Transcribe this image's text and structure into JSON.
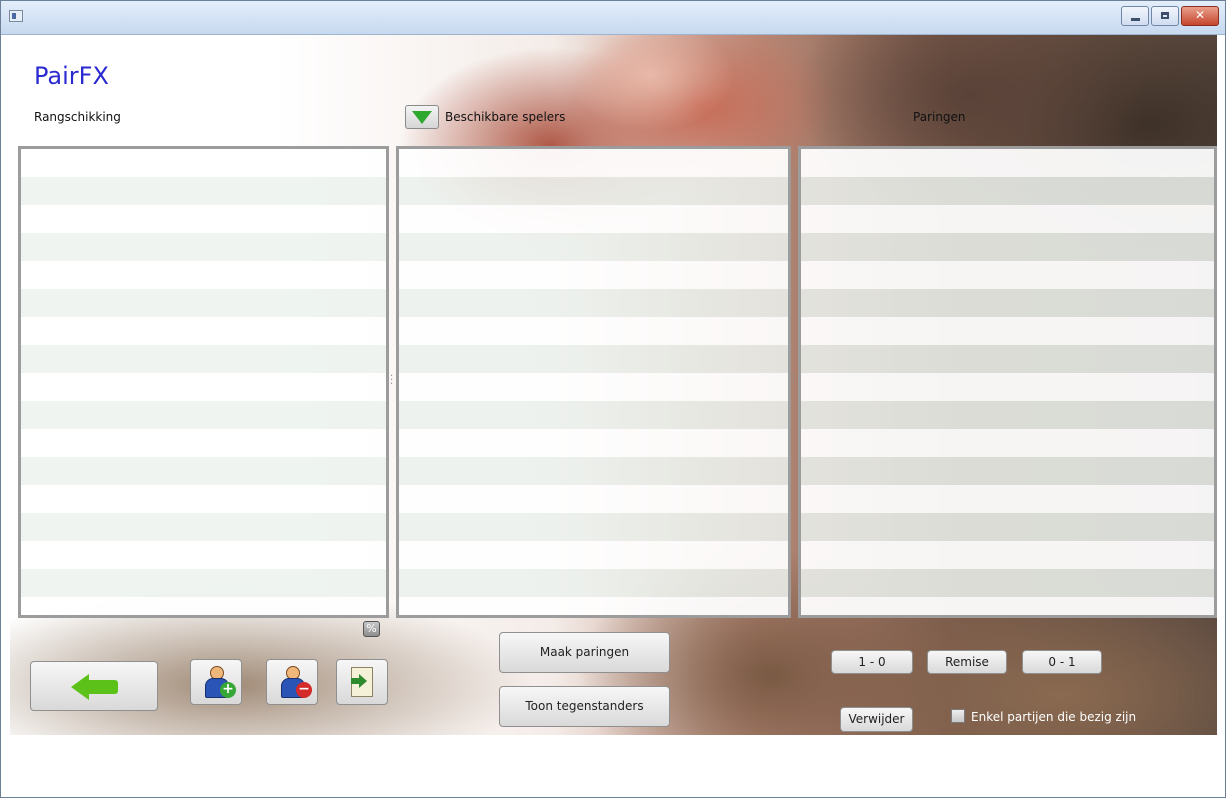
{
  "app": {
    "title": "PairFX"
  },
  "labels": {
    "ranking": "Rangschikking",
    "available_players": "Beschikbare spelers",
    "pairings": "Paringen"
  },
  "buttons": {
    "make_pairings": "Maak paringen",
    "show_opponents": "Toon tegenstanders",
    "white_wins": "1 - 0",
    "draw": "Remise",
    "black_wins": "0 - 1",
    "delete": "Verwijder"
  },
  "filter": {
    "only_active_label": "Enkel partijen die bezig zijn",
    "checked": false
  },
  "icons": {
    "percent_label": "%",
    "back": "back-arrow-icon",
    "add_player": "add-player-icon",
    "remove_player": "remove-player-icon",
    "export": "export-icon",
    "toggle": "triangle-down-icon"
  },
  "colors": {
    "title": "#2a2ad0",
    "arrow_green": "#5cc21a",
    "triangle_green": "#2fa82f"
  }
}
